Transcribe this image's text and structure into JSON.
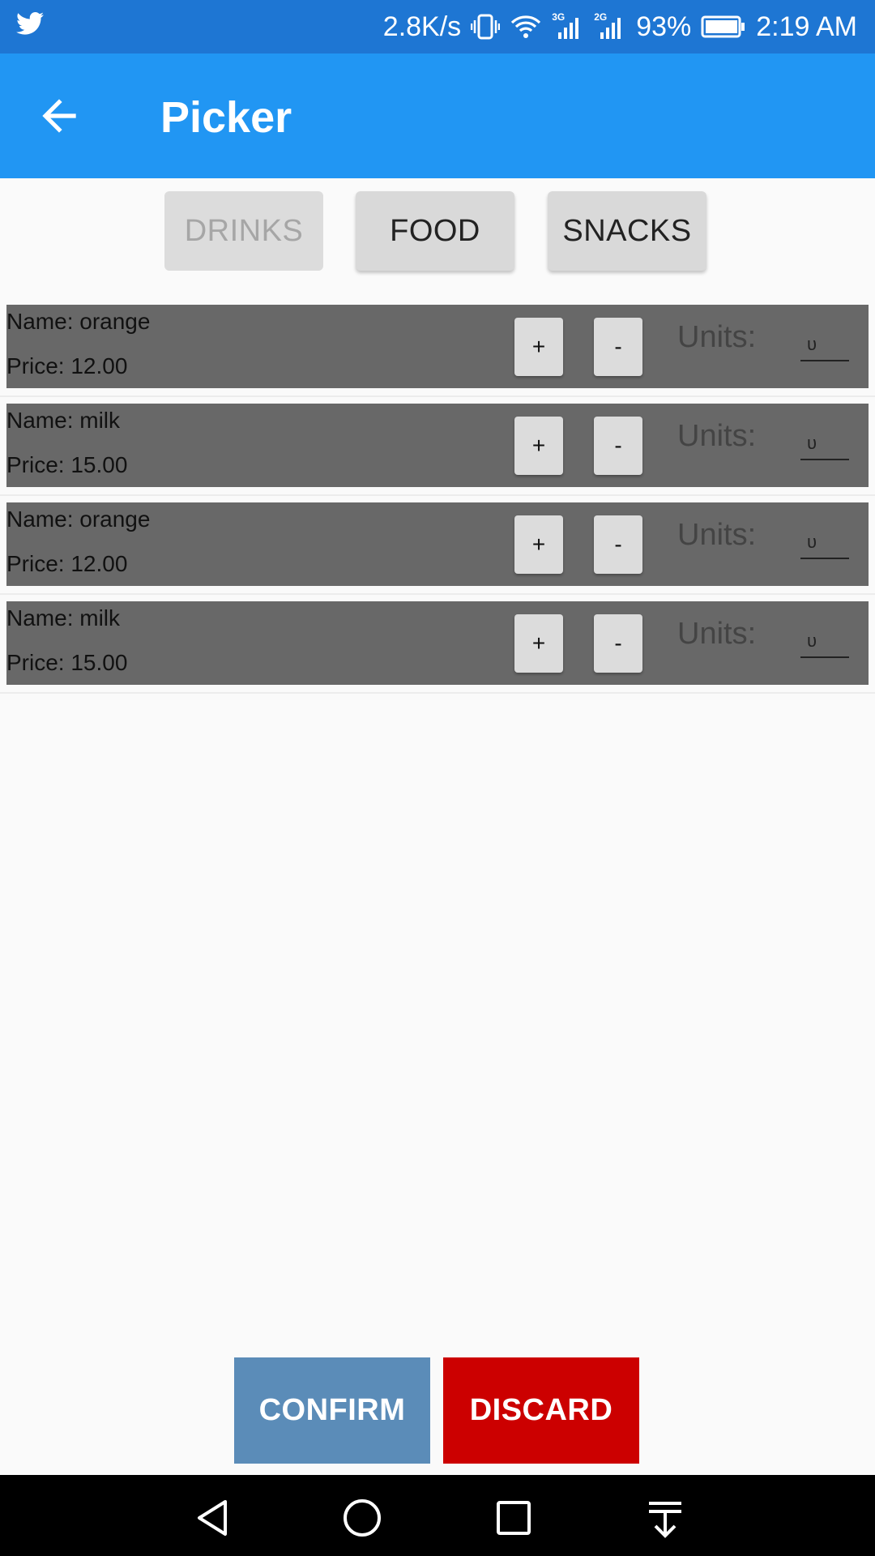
{
  "status_bar": {
    "speed": "2.8K/s",
    "net1": "3G",
    "net2": "2G",
    "battery": "93%",
    "time": "2:19 AM"
  },
  "app_bar": {
    "title": "Picker"
  },
  "categories": [
    "DRINKS",
    "FOOD",
    "SNACKS"
  ],
  "items": [
    {
      "name": "Name: orange",
      "price": "Price: 12.00",
      "plus": "+",
      "minus": "-",
      "units_label": "Units:",
      "units_value": "υ"
    },
    {
      "name": "Name: milk",
      "price": "Price: 15.00",
      "plus": "+",
      "minus": "-",
      "units_label": "Units:",
      "units_value": "υ"
    },
    {
      "name": "Name: orange",
      "price": "Price: 12.00",
      "plus": "+",
      "minus": "-",
      "units_label": "Units:",
      "units_value": "υ"
    },
    {
      "name": "Name: milk",
      "price": "Price: 15.00",
      "plus": "+",
      "minus": "-",
      "units_label": "Units:",
      "units_value": "υ"
    }
  ],
  "actions": {
    "confirm": "CONFIRM",
    "discard": "DISCARD"
  },
  "colors": {
    "status_bar": "#1e76d3",
    "app_bar": "#2196f3",
    "row_bg": "#686868",
    "confirm": "#5b8cb8",
    "discard": "#cc0000"
  }
}
